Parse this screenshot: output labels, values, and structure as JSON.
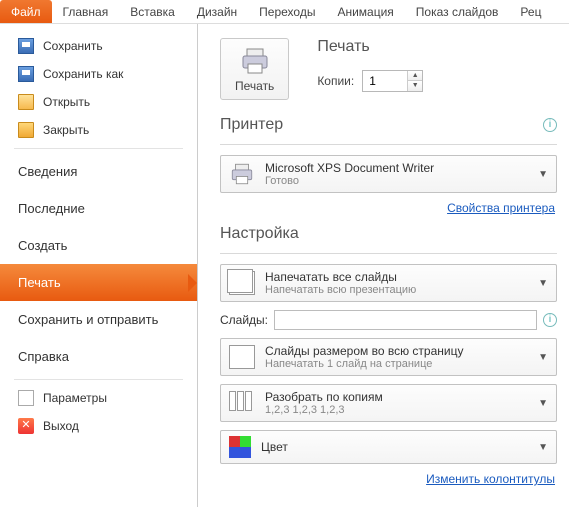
{
  "ribbon": {
    "tabs": [
      "Файл",
      "Главная",
      "Вставка",
      "Дизайн",
      "Переходы",
      "Анимация",
      "Показ слайдов",
      "Рец"
    ]
  },
  "sidebar": {
    "save": "Сохранить",
    "save_as": "Сохранить как",
    "open": "Открыть",
    "close": "Закрыть",
    "info": "Сведения",
    "recent": "Последние",
    "new": "Создать",
    "print": "Печать",
    "share": "Сохранить и отправить",
    "help": "Справка",
    "options": "Параметры",
    "exit": "Выход"
  },
  "content": {
    "print_title": "Печать",
    "print_button": "Печать",
    "copies_label": "Копии:",
    "copies_value": "1",
    "printer_heading": "Принтер",
    "printer_name": "Microsoft XPS Document Writer",
    "printer_status": "Готово",
    "printer_props": "Свойства принтера",
    "settings_heading": "Настройка",
    "opt_all_t1": "Напечатать все слайды",
    "opt_all_t2": "Напечатать всю презентацию",
    "slides_label": "Слайды:",
    "opt_size_t1": "Слайды размером во всю страницу",
    "opt_size_t2": "Напечатать 1 слайд на странице",
    "opt_collate_t1": "Разобрать по копиям",
    "opt_collate_t2": "1,2,3    1,2,3    1,2,3",
    "opt_color": "Цвет",
    "footer_link": "Изменить колонтитулы"
  }
}
